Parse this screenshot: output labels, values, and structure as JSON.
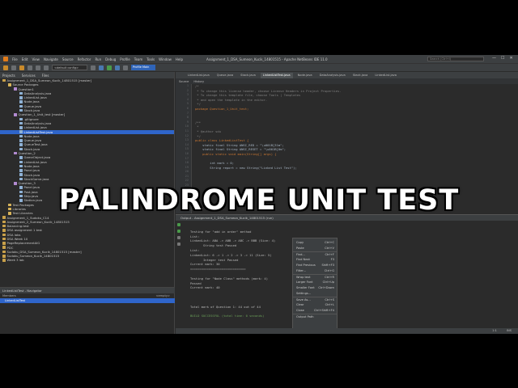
{
  "window": {
    "title": "Assignment_1_DSA_Sumeon_Kucik_14801515 - Apache NetBeans IDE 11.0",
    "menu": [
      "File",
      "Edit",
      "View",
      "Navigate",
      "Source",
      "Refactor",
      "Run",
      "Debug",
      "Profile",
      "Team",
      "Tools",
      "Window",
      "Help"
    ],
    "search_placeholder": "Search (Ctrl+I)",
    "buttons": {
      "minimize": "—",
      "maximize": "☐",
      "close": "✕"
    }
  },
  "toolbar": {
    "config": "<default config>",
    "profile_label": "Profile Main"
  },
  "projects_panel": {
    "tabs": [
      "Projects",
      "Services",
      "Files"
    ],
    "tree": [
      {
        "indent": 0,
        "icon": "proj",
        "label": "Assignment_1_DSA_Sumeon_Kucik_14801515 [master]"
      },
      {
        "indent": 1,
        "icon": "fold",
        "label": "Source Packages"
      },
      {
        "indent": 2,
        "icon": "pkg",
        "label": "Question1"
      },
      {
        "indent": 3,
        "icon": "file",
        "label": "DataAnalysis.java"
      },
      {
        "indent": 3,
        "icon": "file",
        "label": "LinkedList.java"
      },
      {
        "indent": 3,
        "icon": "file",
        "label": "Node.java"
      },
      {
        "indent": 3,
        "icon": "file",
        "label": "Queue.java"
      },
      {
        "indent": 3,
        "icon": "file",
        "label": "Stack.java"
      },
      {
        "indent": 2,
        "icon": "pkg",
        "label": "Question_1_Unit_test [master]"
      },
      {
        "indent": 3,
        "icon": "file",
        "label": ".gitignore"
      },
      {
        "indent": 3,
        "icon": "file",
        "label": "DataAnalysis.java"
      },
      {
        "indent": 3,
        "icon": "file",
        "label": "LinkedList.java"
      },
      {
        "indent": 3,
        "icon": "file",
        "label": "LinkedListTest.java",
        "selected": true
      },
      {
        "indent": 3,
        "icon": "file",
        "label": "Node.java"
      },
      {
        "indent": 3,
        "icon": "file",
        "label": "Queue.java"
      },
      {
        "indent": 3,
        "icon": "file",
        "label": "QueueTest.java"
      },
      {
        "indent": 3,
        "icon": "file",
        "label": "Stack.java"
      },
      {
        "indent": 2,
        "icon": "pkg",
        "label": "Question_2"
      },
      {
        "indent": 3,
        "icon": "file",
        "label": "GameObject.java"
      },
      {
        "indent": 3,
        "icon": "file",
        "label": "LinkedList.java"
      },
      {
        "indent": 3,
        "icon": "file",
        "label": "Node.java"
      },
      {
        "indent": 3,
        "icon": "file",
        "label": "Panel.java"
      },
      {
        "indent": 3,
        "icon": "file",
        "label": "Stack.java"
      },
      {
        "indent": 3,
        "icon": "file",
        "label": "StackGame.java"
      },
      {
        "indent": 2,
        "icon": "pkg",
        "label": "Question_3"
      },
      {
        "indent": 3,
        "icon": "file",
        "label": "Panel.java"
      },
      {
        "indent": 3,
        "icon": "file",
        "label": "Post.java"
      },
      {
        "indent": 3,
        "icon": "file",
        "label": "Ship.java"
      },
      {
        "indent": 3,
        "icon": "file",
        "label": "Station.java"
      },
      {
        "indent": 1,
        "icon": "fold",
        "label": "Test Packages"
      },
      {
        "indent": 1,
        "icon": "fold",
        "label": "Libraries"
      },
      {
        "indent": 1,
        "icon": "fold",
        "label": "Test Libraries"
      },
      {
        "indent": 0,
        "icon": "proj",
        "label": "Assignment_1_Sudoku_C14"
      },
      {
        "indent": 0,
        "icon": "proj",
        "label": "Assignment_2_Sumeon_Kucik_14801515"
      },
      {
        "indent": 0,
        "icon": "proj",
        "label": "Balancing.test"
      },
      {
        "indent": 0,
        "icon": "proj",
        "label": "DSA assignment 1 test"
      },
      {
        "indent": 0,
        "icon": "proj",
        "label": "DSA labs"
      },
      {
        "indent": 0,
        "icon": "proj",
        "label": "DSA Week 10"
      },
      {
        "indent": 0,
        "icon": "proj",
        "label": "PageReplacementAlG"
      },
      {
        "indent": 0,
        "icon": "proj",
        "label": "PDC"
      },
      {
        "indent": 0,
        "icon": "proj",
        "label": "Sudoku_DSA_Sumeon_Kucik_14801515 [master]"
      },
      {
        "indent": 0,
        "icon": "proj",
        "label": "Sudoku_Sumeon_Kucik_14801515"
      },
      {
        "indent": 0,
        "icon": "proj",
        "label": "Week 3 lab"
      }
    ]
  },
  "navigator": {
    "title": "LinkedListTest - Navigator",
    "members_label": "Members",
    "empty_label": "<empty>",
    "selected": "LinkedListTest"
  },
  "editor": {
    "tabs": [
      "LinkedList.java",
      "Queue.java",
      "Stack.java",
      "LinkedListTest.java",
      "Node.java",
      "DataAnalysis.java",
      "Stack.java",
      "LinkedList.java"
    ],
    "active_tab": 3,
    "source_tab": "Source",
    "history_tab": "History",
    "line_numbers": [
      "1",
      "2",
      "3",
      "4",
      "5",
      "6",
      "7",
      "8",
      "9",
      "10",
      "11",
      "12",
      "13",
      "14",
      "15",
      "16",
      "17",
      "18",
      "19",
      "20",
      "21",
      "22",
      "23",
      "24",
      "25",
      "26",
      "27",
      "28"
    ],
    "lines": [
      {
        "t": "/*",
        "c": "cm"
      },
      {
        "t": " * To change this license header, choose License Headers in Project Properties.",
        "c": "cm"
      },
      {
        "t": " * To change this template file, choose Tools | Templates",
        "c": "cm"
      },
      {
        "t": " * and open the template in the editor.",
        "c": "cm"
      },
      {
        "t": " */",
        "c": "cm"
      },
      {
        "t": "package Question_1_Unit_test;",
        "c": "kw"
      },
      {
        "t": "",
        "c": ""
      },
      {
        "t": "",
        "c": ""
      },
      {
        "t": "/**",
        "c": "cm"
      },
      {
        "t": " *",
        "c": "cm"
      },
      {
        "t": " * @author sdu",
        "c": "cm"
      },
      {
        "t": " */",
        "c": "cm"
      },
      {
        "t": "public class LinkedListTest {",
        "c": "kw"
      },
      {
        "t": "    static final String ANSI_RED = \"\\u001B[31m\";",
        "c": ""
      },
      {
        "t": "    static final String ANSI_RESET = \"\\u001B[0m\";",
        "c": ""
      },
      {
        "t": "    public static void main(String[] args) {",
        "c": "kw"
      },
      {
        "t": "",
        "c": ""
      },
      {
        "t": "        int mark = 0;",
        "c": ""
      },
      {
        "t": "        String report = new String(\"Linked List Test\");",
        "c": ""
      }
    ]
  },
  "output": {
    "title": "Output - Assignment_1_DSA_Sumeon_Kucik_14801515 (run)",
    "lines": [
      {
        "t": "",
        "c": ""
      },
      {
        "t": "Testing for \"add in order\" method",
        "c": ""
      },
      {
        "t": "List:",
        "c": ""
      },
      {
        "t": "LinkedList: ABA -> ABB -> ABC -> BBB (Size: 4)",
        "c": ""
      },
      {
        "t": "       String test Passed",
        "c": ""
      },
      {
        "t": "List:",
        "c": ""
      },
      {
        "t": "LinkedList: 6 -> 1 -> 2 -> 3 -> 11 (Size: 5)",
        "c": ""
      },
      {
        "t": "       Integer test Passed",
        "c": ""
      },
      {
        "t": "Current mark: 30",
        "c": ""
      },
      {
        "t": "==============================",
        "c": ""
      },
      {
        "t": "",
        "c": ""
      },
      {
        "t": "Testing for \"Node Class\" methods (mark: 4)",
        "c": ""
      },
      {
        "t": "Passed",
        "c": ""
      },
      {
        "t": "Current mark: 40",
        "c": ""
      },
      {
        "t": "",
        "c": ""
      },
      {
        "t": "",
        "c": ""
      },
      {
        "t": "",
        "c": ""
      },
      {
        "t": "Total mark of Question 1: 44 out of 44",
        "c": ""
      },
      {
        "t": "",
        "c": ""
      },
      {
        "t": "BUILD SUCCESSFUL (total time: 0 seconds)",
        "c": "ok"
      }
    ]
  },
  "context_menu": [
    {
      "label": "Copy",
      "key": "Ctrl+C",
      "sep": false
    },
    {
      "label": "Paste",
      "key": "Ctrl+V",
      "sep": false
    },
    {
      "label": "Find...",
      "key": "Ctrl+F",
      "sep": true
    },
    {
      "label": "Find Next",
      "key": "F3",
      "sep": false
    },
    {
      "label": "Find Previous",
      "key": "Shift+F3",
      "sep": false
    },
    {
      "label": "Filter...",
      "key": "Ctrl+G",
      "sep": false
    },
    {
      "label": "Wrap text",
      "key": "Ctrl+R",
      "sep": true
    },
    {
      "label": "Larger Font",
      "key": "Ctrl+Up",
      "sep": false
    },
    {
      "label": "Smaller Font",
      "key": "Ctrl+Down",
      "sep": false
    },
    {
      "label": "Settings...",
      "key": "",
      "sep": false
    },
    {
      "label": "Save As...",
      "key": "Ctrl+S",
      "sep": true
    },
    {
      "label": "Clear",
      "key": "Ctrl+L",
      "sep": false
    },
    {
      "label": "Close",
      "key": "Ctrl+Shift+F4",
      "sep": false
    },
    {
      "label": "Output Path",
      "key": "",
      "sep": true
    }
  ],
  "status_bar": {
    "position": "1:1",
    "mode": "INS"
  },
  "overlay_title": "PALINDROME UNIT TEST"
}
